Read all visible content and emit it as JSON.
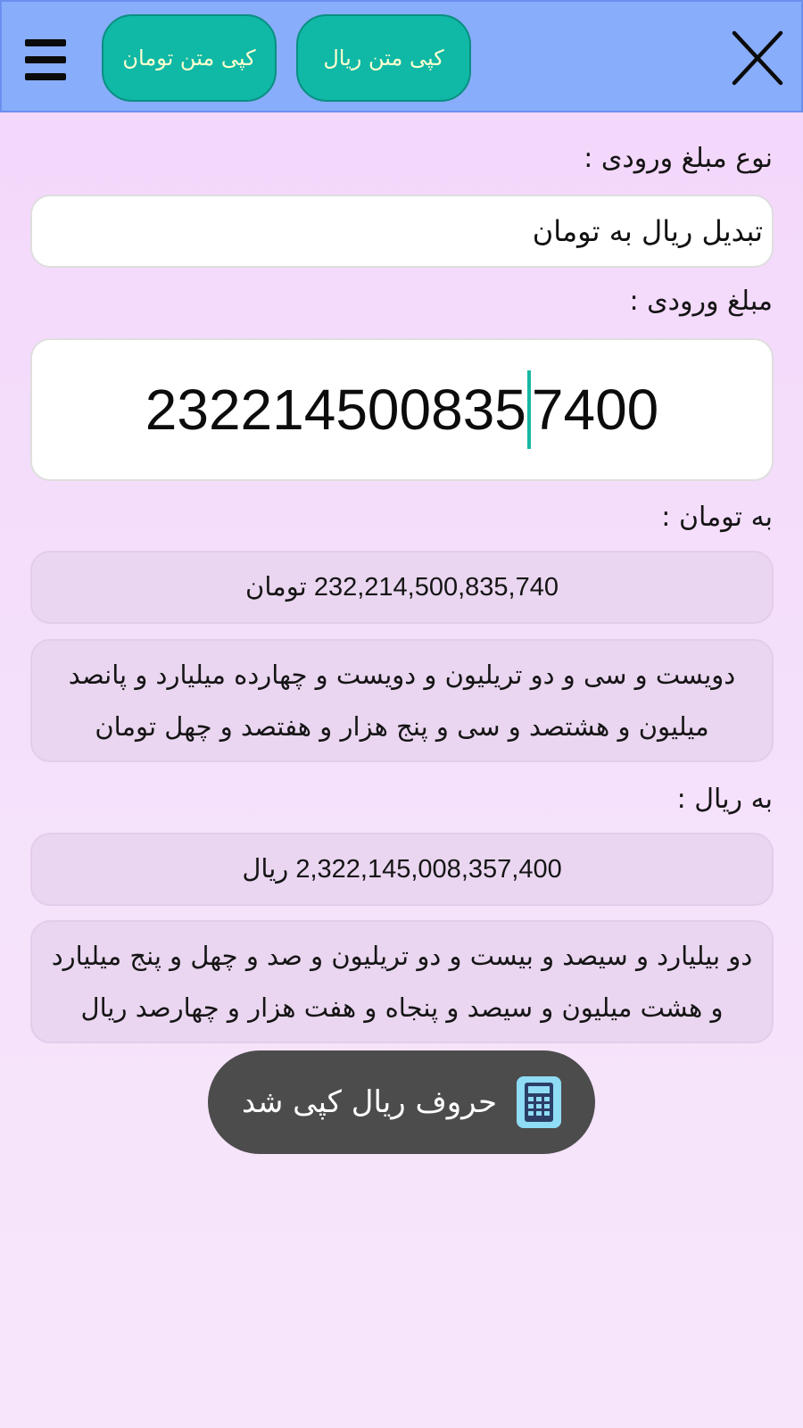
{
  "topbar": {
    "copy_toman_label": "کپی متن تومان",
    "copy_rial_label": "کپی متن ریال",
    "bg_color": "#88adfa",
    "button_color": "#10b8a6"
  },
  "form": {
    "type_label": "نوع مبلغ ورودی :",
    "type_value": "تبدیل ریال به تومان",
    "amount_label": "مبلغ ورودی :",
    "amount_value_before_caret": "232214500835",
    "amount_value_after_caret": "7400"
  },
  "toman": {
    "label": "به تومان :",
    "number": "232,214,500,835,740 تومان",
    "words": "دویست و سی و دو تریلیون و دویست و چهارده میلیارد و پانصد میلیون و هشتصد و سی و پنج هزار و هفتصد و چهل تومان"
  },
  "rial": {
    "label": "به ریال :",
    "number": "2,322,145,008,357,400 ریال",
    "words": "دو بیلیارد و سیصد و بیست و دو تریلیون و صد و چهل و پنج میلیارد و هشت میلیون و سیصد و پنجاه و هفت هزار و چهارصد ریال"
  },
  "toast": {
    "message": "حروف ریال کپی شد",
    "icon": "calculator-icon"
  }
}
